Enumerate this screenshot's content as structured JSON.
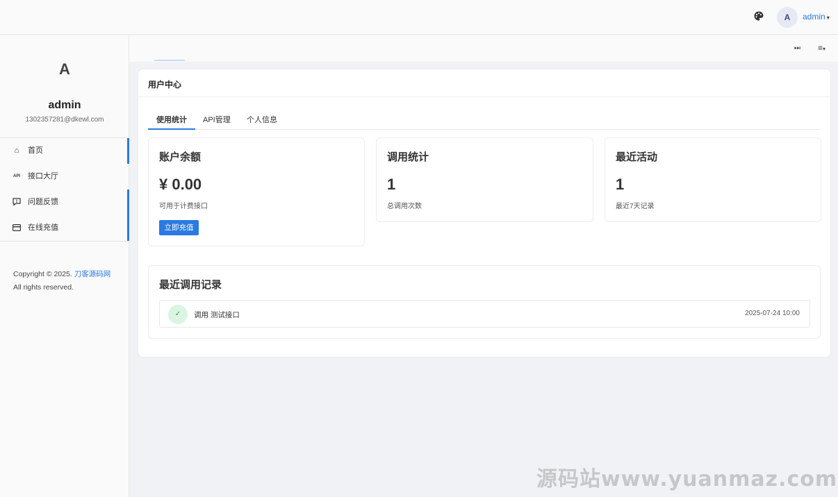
{
  "header": {
    "palette_icon": "palette-icon",
    "avatar_letter": "A",
    "username": "admin",
    "caret": "▾"
  },
  "subbar": {
    "skip_icon": "⏭",
    "menu_icon": "≡",
    "caret": "▾"
  },
  "sidebar": {
    "logo_letter": "A",
    "name": "admin",
    "email": "1302357281@dkewl.com",
    "items": [
      {
        "label": "首页",
        "icon": "home-icon"
      },
      {
        "label": "接口大厅",
        "icon": "api-icon"
      },
      {
        "label": "问题反馈",
        "icon": "feedback-icon"
      },
      {
        "label": "在线充值",
        "icon": "card-icon"
      }
    ],
    "copyright_prefix": "Copyright © 2025.",
    "copyright_link": "刀客源码网",
    "rights": "All rights reserved."
  },
  "main": {
    "title": "用户中心",
    "tabs": [
      {
        "label": "使用统计",
        "active": true
      },
      {
        "label": "API管理",
        "active": false
      },
      {
        "label": "个人信息",
        "active": false
      }
    ],
    "stats": [
      {
        "title": "账户余额",
        "value": "¥ 0.00",
        "desc": "可用于计费接口",
        "button": "立即充值"
      },
      {
        "title": "调用统计",
        "value": "1",
        "desc": "总调用次数"
      },
      {
        "title": "最近活动",
        "value": "1",
        "desc": "最近7天记录"
      }
    ],
    "recent": {
      "title": "最近调用记录",
      "records": [
        {
          "label": "调用 测试接口",
          "time": "2025-07-24 10:00",
          "status_icon": "check-icon"
        }
      ]
    }
  },
  "watermark": "源码站www.yuanmaz.com",
  "colors": {
    "accent": "#2a7ae2",
    "success_bg": "#dcf5e3",
    "success": "#2b9a52"
  }
}
